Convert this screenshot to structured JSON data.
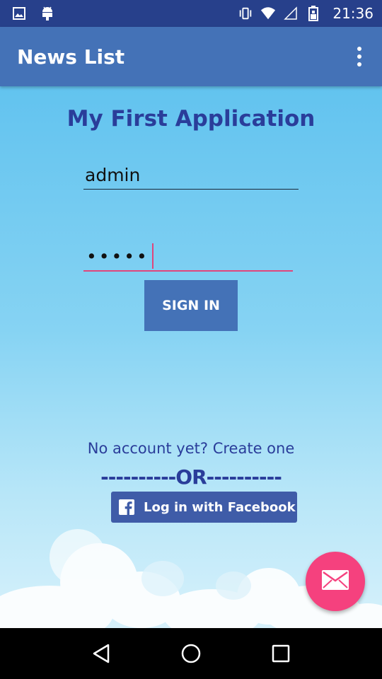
{
  "status_bar": {
    "time": "21:36",
    "icons": [
      "gallery-icon",
      "android-icon",
      "vibrate-icon",
      "wifi-icon",
      "signal-icon",
      "battery-icon"
    ]
  },
  "app_bar": {
    "title": "News List",
    "overflow_icon": "more-vert-icon"
  },
  "login": {
    "heading": "My First Application",
    "username_value": "admin",
    "password_value": "•••••",
    "sign_in_label": "SIGN IN",
    "create_account_text": "No account yet? Create one",
    "or_divider": "----------OR----------",
    "facebook_label": "Log in with Facebook"
  },
  "fab": {
    "icon": "mail-icon"
  },
  "nav_bar": {
    "buttons": [
      "back-icon",
      "home-icon",
      "recents-icon"
    ]
  },
  "colors": {
    "status_bar": "#27408b",
    "app_bar": "#4472b7",
    "heading": "#2a3d9a",
    "accent_pink": "#f5417e",
    "facebook": "#3f5ca8"
  }
}
